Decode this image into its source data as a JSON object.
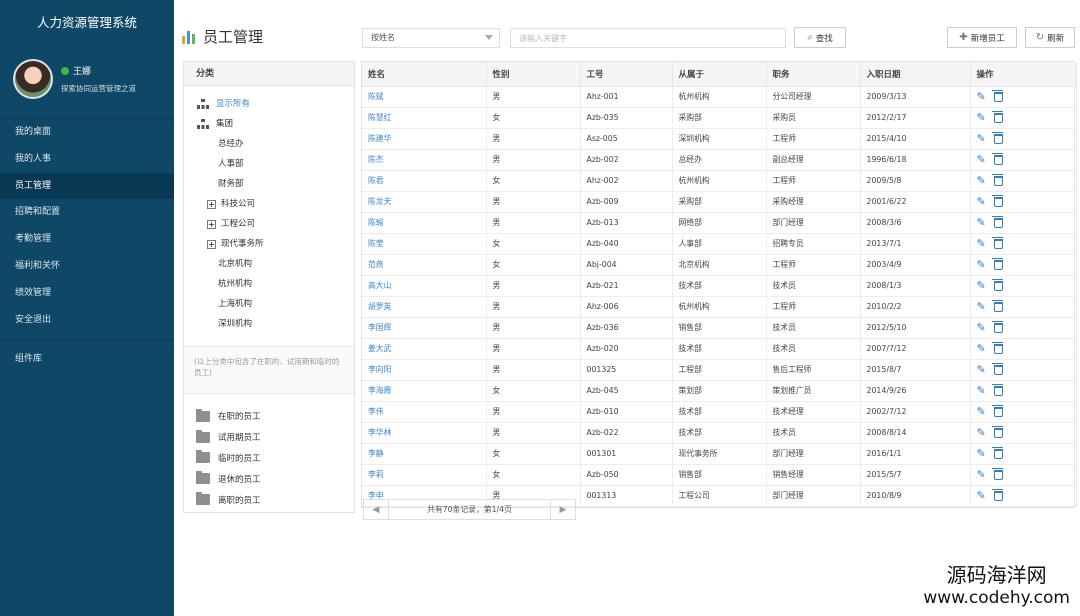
{
  "app": {
    "title": "人力资源管理系统"
  },
  "user": {
    "name": "王娜",
    "motto": "探索协同运营管理之道"
  },
  "menu": [
    {
      "label": "我的桌面",
      "active": false
    },
    {
      "label": "我的人事",
      "active": false
    },
    {
      "label": "员工管理",
      "active": true
    },
    {
      "label": "招聘和配置",
      "active": false
    },
    {
      "label": "考勤管理",
      "active": false
    },
    {
      "label": "福利和关怀",
      "active": false
    },
    {
      "label": "绩效管理",
      "active": false
    },
    {
      "label": "安全退出",
      "active": false
    }
  ],
  "menu_extra": {
    "label": "组件库"
  },
  "page": {
    "title": "员工管理"
  },
  "toolbar": {
    "search_field": "按姓名",
    "search_placeholder": "请输入关键字",
    "search_label": "查找",
    "add_label": "新增员工",
    "refresh_label": "刷新"
  },
  "category": {
    "header": "分类",
    "tree": [
      {
        "label": "显示所有",
        "type": "org",
        "link": true,
        "indent": 0
      },
      {
        "label": "集团",
        "type": "org",
        "link": false,
        "indent": 0
      },
      {
        "label": "总经办",
        "type": "leaf",
        "link": false,
        "indent": 1
      },
      {
        "label": "人事部",
        "type": "leaf",
        "link": false,
        "indent": 1
      },
      {
        "label": "财务部",
        "type": "leaf",
        "link": false,
        "indent": 1
      },
      {
        "label": "科技公司",
        "type": "plus",
        "link": false,
        "indent": 0.5
      },
      {
        "label": "工程公司",
        "type": "plus",
        "link": false,
        "indent": 0.5
      },
      {
        "label": "现代事务所",
        "type": "plus",
        "link": false,
        "indent": 0.5
      },
      {
        "label": "北京机构",
        "type": "leaf",
        "link": false,
        "indent": 1
      },
      {
        "label": "杭州机构",
        "type": "leaf",
        "link": false,
        "indent": 1
      },
      {
        "label": "上海机构",
        "type": "leaf",
        "link": false,
        "indent": 1
      },
      {
        "label": "深圳机构",
        "type": "leaf",
        "link": false,
        "indent": 1
      }
    ],
    "note": "(以上分类中包含了在职的、试用期和临时的员工)",
    "folders": [
      "在职的员工",
      "试用期员工",
      "临时的员工",
      "退休的员工",
      "离职的员工"
    ]
  },
  "table": {
    "columns": [
      "姓名",
      "性别",
      "工号",
      "从属于",
      "职务",
      "入职日期",
      "操作"
    ],
    "rows": [
      [
        "陈斌",
        "男",
        "Ahz-001",
        "杭州机构",
        "分公司经理",
        "2009/3/13"
      ],
      [
        "陈慧红",
        "女",
        "Azb-035",
        "采购部",
        "采购员",
        "2012/2/17"
      ],
      [
        "陈建华",
        "男",
        "Asz-005",
        "深圳机构",
        "工程师",
        "2015/4/10"
      ],
      [
        "陈杰",
        "男",
        "Azb-002",
        "总经办",
        "副总经理",
        "1996/6/18"
      ],
      [
        "陈君",
        "女",
        "Ahz-002",
        "杭州机构",
        "工程师",
        "2009/5/8"
      ],
      [
        "陈龙天",
        "男",
        "Azb-009",
        "采购部",
        "采购经理",
        "2001/6/22"
      ],
      [
        "陈瑜",
        "男",
        "Azb-013",
        "网络部",
        "部门经理",
        "2008/3/6"
      ],
      [
        "陈莹",
        "女",
        "Azb-040",
        "人事部",
        "招聘专员",
        "2013/7/1"
      ],
      [
        "范燕",
        "女",
        "Abj-004",
        "北京机构",
        "工程师",
        "2003/4/9"
      ],
      [
        "高大山",
        "男",
        "Azb-021",
        "技术部",
        "技术员",
        "2008/1/3"
      ],
      [
        "胡罗英",
        "男",
        "Ahz-006",
        "杭州机构",
        "工程师",
        "2010/2/2"
      ],
      [
        "李国辉",
        "男",
        "Azb-036",
        "销售部",
        "技术员",
        "2012/5/10"
      ],
      [
        "姜大武",
        "男",
        "Azb-020",
        "技术部",
        "技术员",
        "2007/7/12"
      ],
      [
        "李向阳",
        "男",
        "001325",
        "工程部",
        "售后工程师",
        "2015/8/7"
      ],
      [
        "李海霞",
        "女",
        "Azb-045",
        "策划部",
        "策划推广员",
        "2014/9/26"
      ],
      [
        "李伟",
        "男",
        "Azb-010",
        "技术部",
        "技术经理",
        "2002/7/12"
      ],
      [
        "李华林",
        "男",
        "Azb-022",
        "技术部",
        "技术员",
        "2008/8/14"
      ],
      [
        "李静",
        "女",
        "001301",
        "现代事务所",
        "部门经理",
        "2016/1/1"
      ],
      [
        "李莉",
        "女",
        "Azb-050",
        "销售部",
        "销售经理",
        "2015/5/7"
      ],
      [
        "李申",
        "男",
        "001313",
        "工程公司",
        "部门经理",
        "2010/8/9"
      ]
    ]
  },
  "pager": {
    "info": "共有70条记录，第1/4页",
    "prev": "◀",
    "next": "▶"
  },
  "watermark": {
    "line1": "源码海洋网",
    "line2": "www.codehy.com"
  },
  "colors": {
    "sidebar": "#0f4766",
    "link": "#3a86c8",
    "action": "#2f7ec6"
  },
  "icons": {
    "edit": "edit-icon",
    "delete": "trash-icon",
    "search": "search-icon",
    "add": "plus-icon",
    "refresh": "refresh-icon"
  }
}
